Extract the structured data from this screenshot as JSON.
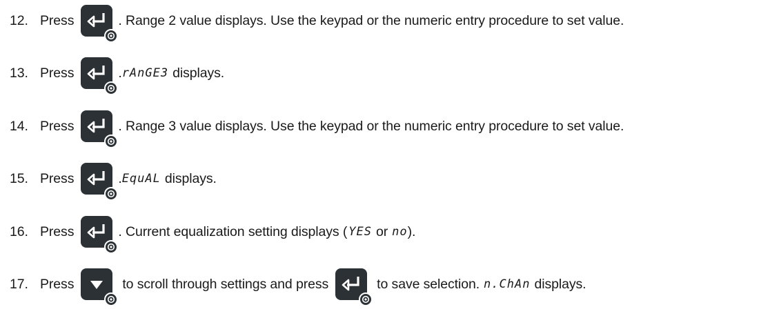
{
  "steps": [
    {
      "number": "12.",
      "press": "Press",
      "key": "enter",
      "text": ". Range 2 value displays. Use the keypad or the numeric entry procedure to set value."
    },
    {
      "number": "13.",
      "press": "Press",
      "key": "enter",
      "prefix": ". ",
      "lcd": "rAnGE3",
      "text": "displays."
    },
    {
      "number": "14.",
      "press": "Press",
      "key": "enter",
      "text": ". Range 3 value displays. Use the keypad or the numeric entry procedure to set value."
    },
    {
      "number": "15.",
      "press": "Press",
      "key": "enter",
      "prefix": ". ",
      "lcd": "EquAL",
      "text": "displays."
    },
    {
      "number": "16.",
      "press": "Press",
      "key": "enter",
      "text_a": ". Current equalization setting displays (",
      "lcd_a": "YES",
      "text_b": "or",
      "lcd_b": "no",
      "text_c": ")."
    },
    {
      "number": "17.",
      "press": "Press",
      "key": "down",
      "text_a": "to scroll through settings and press",
      "key2": "enter",
      "text_b": "to save selection.",
      "lcd": "n.ChAn",
      "text_c": "displays."
    }
  ],
  "icons": {
    "enter_key": "enter-key-icon",
    "down_key": "down-arrow-key-icon",
    "badge": "gear-icon"
  },
  "colors": {
    "key_background": "#2b3135",
    "text": "#1a1a1a"
  }
}
